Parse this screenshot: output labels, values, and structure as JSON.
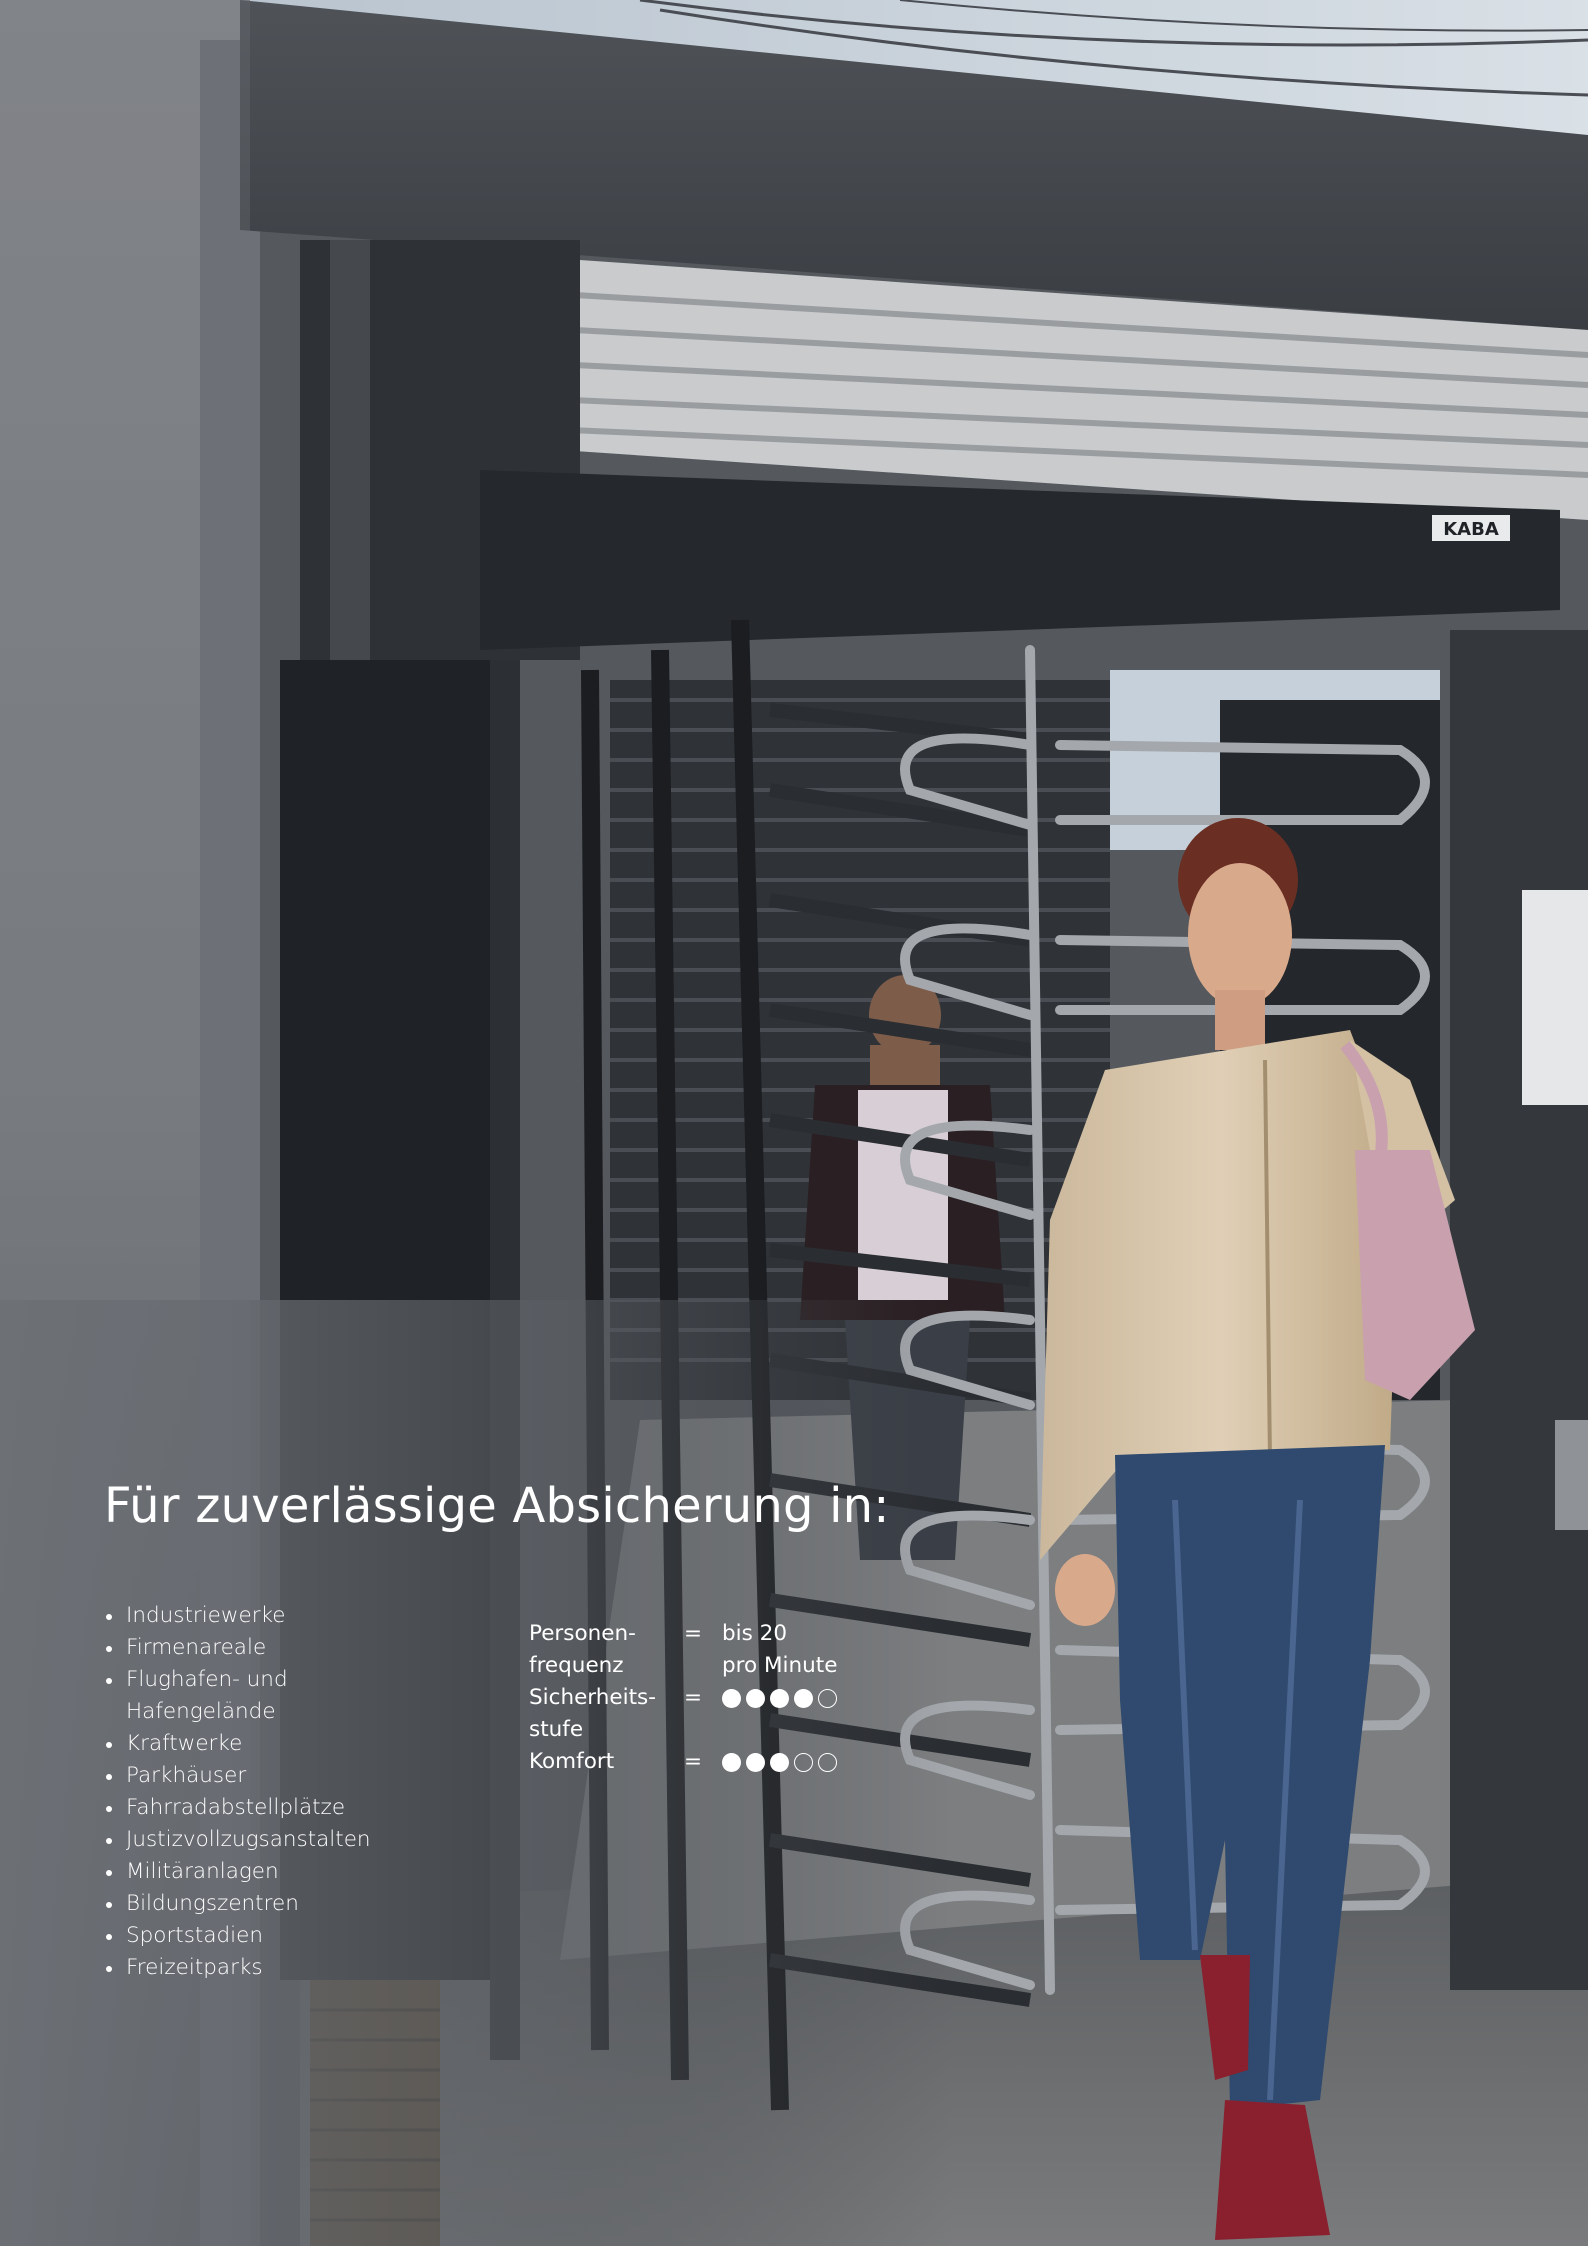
{
  "headline": "Für zuverlässige Absicherung in:",
  "applications": [
    "Industriewerke",
    "Firmenareale",
    "Flughafen- und\nHafengelände",
    "Kraftwerke",
    "Parkhäuser",
    "Fahrradabstellplätze",
    "Justizvollzugsanstalten",
    "Militäranlagen",
    "Bildungszentren",
    "Sportstadien",
    "Freizeitparks"
  ],
  "specs": {
    "frequency": {
      "label": "Personen-\nfrequenz",
      "equals": "=",
      "value": "bis 20\npro Minute"
    },
    "security": {
      "label": "Sicherheits-\nstufe",
      "equals": "=",
      "rating": 4,
      "max": 5
    },
    "comfort": {
      "label": "Komfort",
      "equals": "=",
      "rating": 3,
      "max": 5
    }
  },
  "photo": {
    "brand_plate": "KABA",
    "colors": {
      "sky": "#c9d3dc",
      "wall": "#3c4046",
      "steel": "#8a8f96",
      "jacket": "#d8c6ac",
      "jeans": "#2f4a6e",
      "shoes": "#8a1f2e",
      "bag": "#c9a0ad"
    }
  }
}
